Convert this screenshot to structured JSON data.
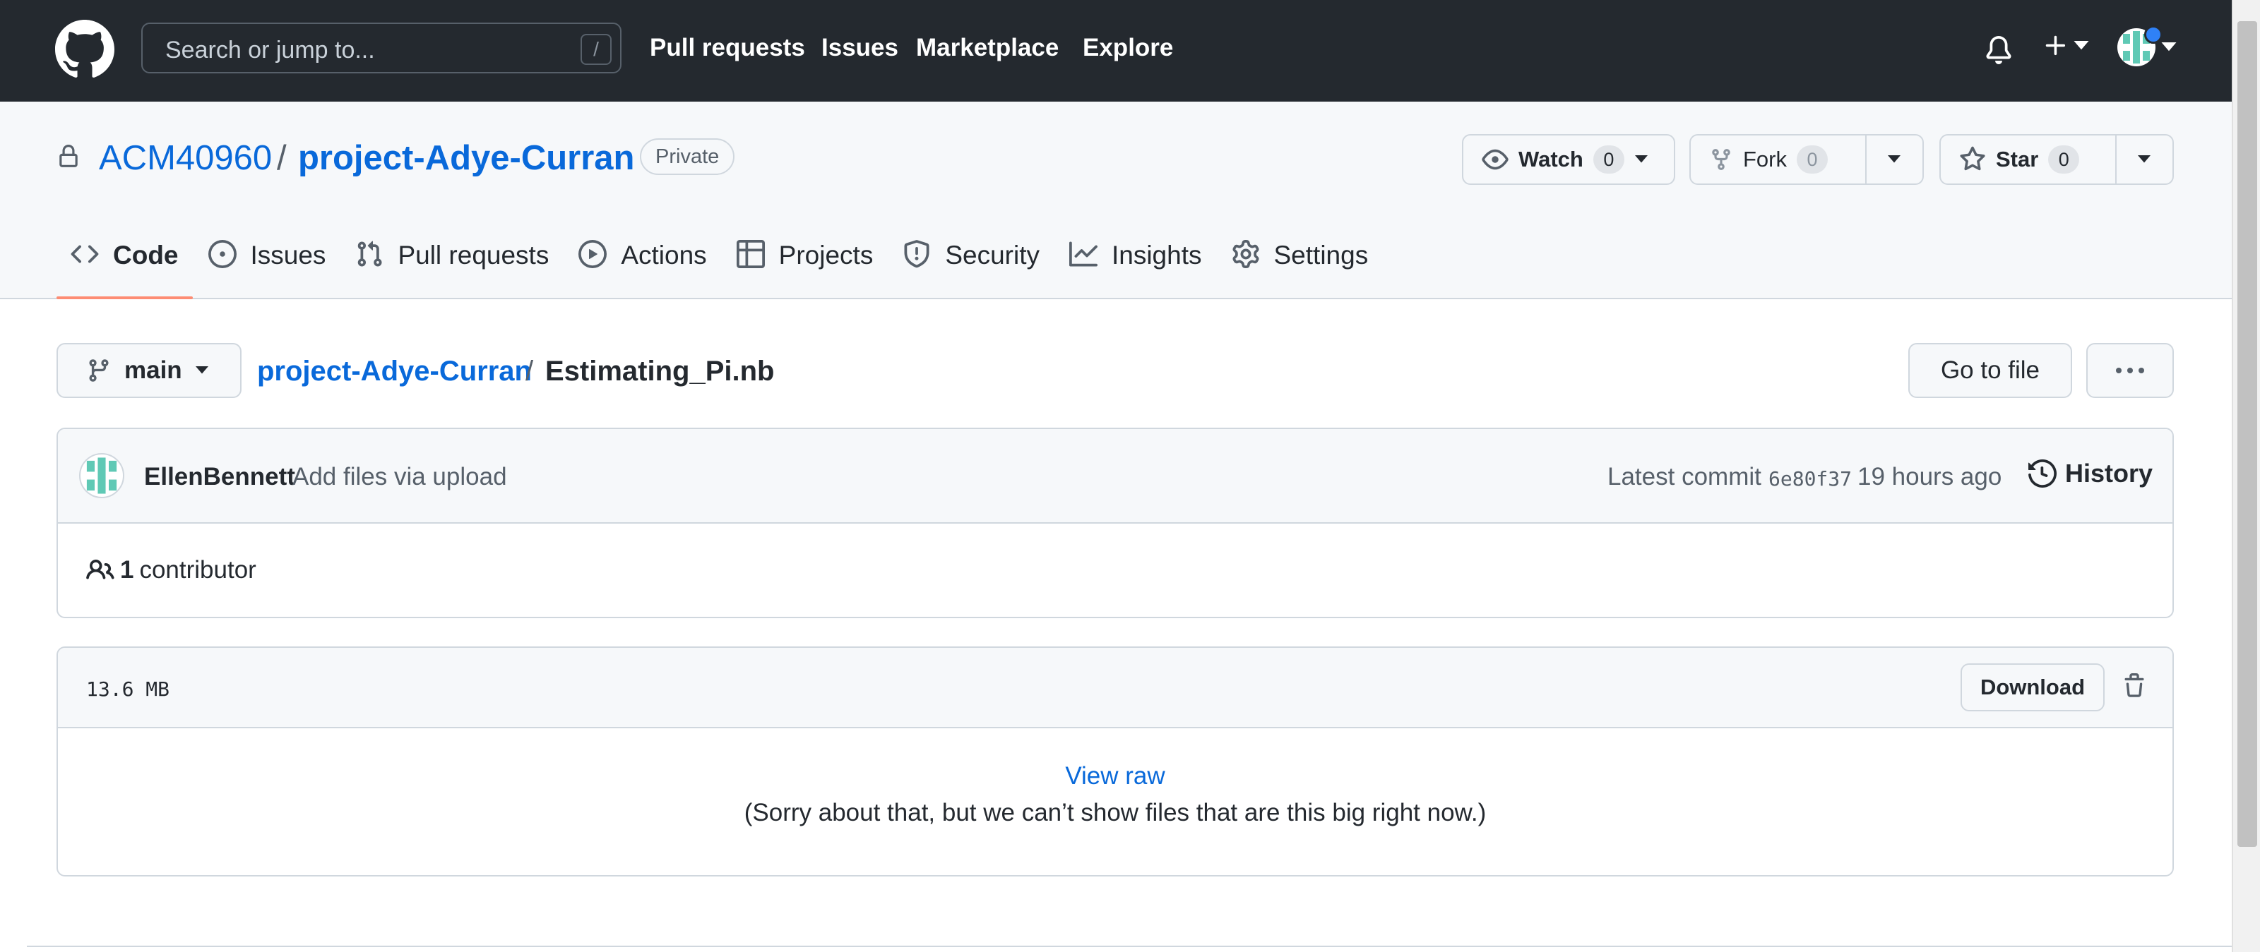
{
  "header": {
    "search_placeholder": "Search or jump to...",
    "search_shortcut": "/",
    "nav": [
      "Pull requests",
      "Issues",
      "Marketplace",
      "Explore"
    ],
    "bg_color": "#24292f",
    "icons": [
      "github-mark-icon",
      "bell-icon",
      "plus-icon",
      "avatar-icon"
    ]
  },
  "repo": {
    "owner": "ACM40960",
    "separator": "/",
    "name": "project-Adye-Curran",
    "visibility": "Private",
    "watch": {
      "label": "Watch",
      "count": "0"
    },
    "fork": {
      "label": "Fork",
      "count": "0"
    },
    "star": {
      "label": "Star",
      "count": "0"
    },
    "tabs": [
      {
        "label": "Code",
        "icon": "code-icon",
        "active": true
      },
      {
        "label": "Issues",
        "icon": "issue-opened-icon"
      },
      {
        "label": "Pull requests",
        "icon": "git-pull-request-icon"
      },
      {
        "label": "Actions",
        "icon": "play-icon"
      },
      {
        "label": "Projects",
        "icon": "table-icon"
      },
      {
        "label": "Security",
        "icon": "shield-icon"
      },
      {
        "label": "Insights",
        "icon": "graph-icon"
      },
      {
        "label": "Settings",
        "icon": "gear-icon"
      }
    ],
    "active_tab_color": "#fd8c73"
  },
  "file": {
    "branch": "main",
    "crumb_repo": "project-Adye-Curran",
    "crumb_separator": "/",
    "filename": "Estimating_Pi.nb",
    "go_to_file": "Go to file",
    "commit": {
      "author": "EllenBennett",
      "message": "Add files via upload",
      "latest_label": "Latest commit",
      "sha": "6e80f37",
      "age": "19 hours ago",
      "history_label": "History"
    },
    "contributors": {
      "count": "1",
      "label": "contributor"
    },
    "size": "13.6 MB",
    "download_label": "Download",
    "view_raw": "View raw",
    "too_big_message": "(Sorry about that, but we can’t show files that are this big right now.)"
  },
  "colors": {
    "link": "#0969da",
    "border": "#d0d7de",
    "canvas_subtle": "#f6f8fa"
  }
}
